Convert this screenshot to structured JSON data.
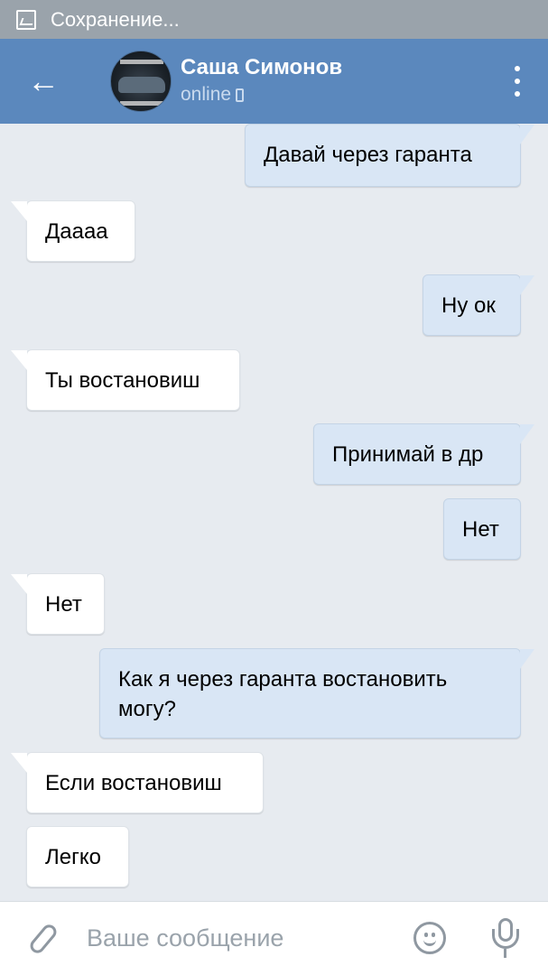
{
  "status_bar": {
    "text": "Сохранение..."
  },
  "header": {
    "contact_name": "Саша Симонов",
    "contact_status": "online"
  },
  "messages": [
    {
      "side": "out",
      "text": "Давай через гаранта"
    },
    {
      "side": "in",
      "text": "Даааа"
    },
    {
      "side": "out",
      "text": "Ну ок"
    },
    {
      "side": "in",
      "text": "Ты востановиш"
    },
    {
      "side": "out",
      "text": "Принимай в др"
    },
    {
      "side": "out",
      "text": "Нет"
    },
    {
      "side": "in",
      "text": "Нет"
    },
    {
      "side": "out",
      "text": "Как я через гаранта востановить могу?"
    },
    {
      "side": "in",
      "text": "Если востановиш"
    },
    {
      "side": "in",
      "text": "Легко"
    }
  ],
  "composer": {
    "placeholder": "Ваше сообщение"
  },
  "icons": [
    "image-icon",
    "back-arrow-icon",
    "avatar",
    "phone-icon",
    "more-vertical-icon",
    "paperclip-icon",
    "emoji-icon",
    "microphone-icon"
  ],
  "colors": {
    "header": "#5b88bd",
    "outgoing_bubble": "#d9e6f5",
    "incoming_bubble": "#ffffff",
    "background": "#e7ebf0"
  }
}
